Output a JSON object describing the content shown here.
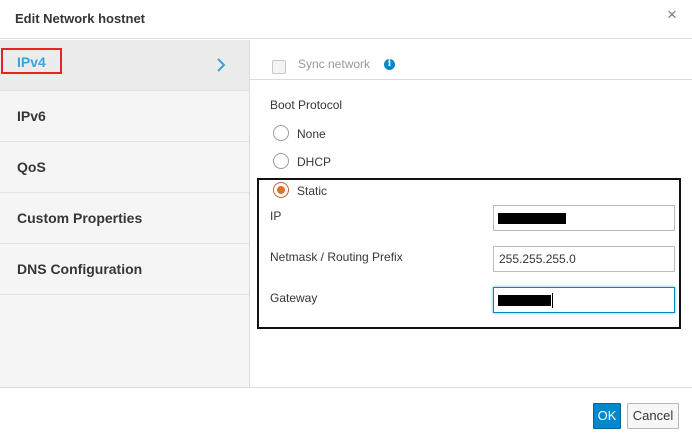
{
  "dialog": {
    "title": "Edit Network hostnet",
    "close_icon": "close-icon"
  },
  "sidebar": {
    "items": [
      {
        "label": "IPv4",
        "active": true
      },
      {
        "label": "IPv6",
        "active": false
      },
      {
        "label": "QoS",
        "active": false
      },
      {
        "label": "Custom Properties",
        "active": false
      },
      {
        "label": "DNS Configuration",
        "active": false
      }
    ],
    "active_icon": "chevron-right-icon"
  },
  "content": {
    "sync_label": "Sync network",
    "sync_checked": false,
    "sync_info_icon": "info-icon",
    "boot_protocol_label": "Boot Protocol",
    "boot_options": [
      {
        "label": "None",
        "selected": false
      },
      {
        "label": "DHCP",
        "selected": false
      },
      {
        "label": "Static",
        "selected": true
      }
    ],
    "fields": {
      "ip_label": "IP",
      "ip_value": "",
      "netmask_label": "Netmask / Routing Prefix",
      "netmask_value": "255.255.255.0",
      "gateway_label": "Gateway",
      "gateway_value": ""
    }
  },
  "footer": {
    "ok_label": "OK",
    "cancel_label": "Cancel"
  },
  "colors": {
    "accent": "#0088ce",
    "active_tab_text": "#39a5dc",
    "radio_selected": "#e07030",
    "highlight_border": "#e5242a"
  }
}
